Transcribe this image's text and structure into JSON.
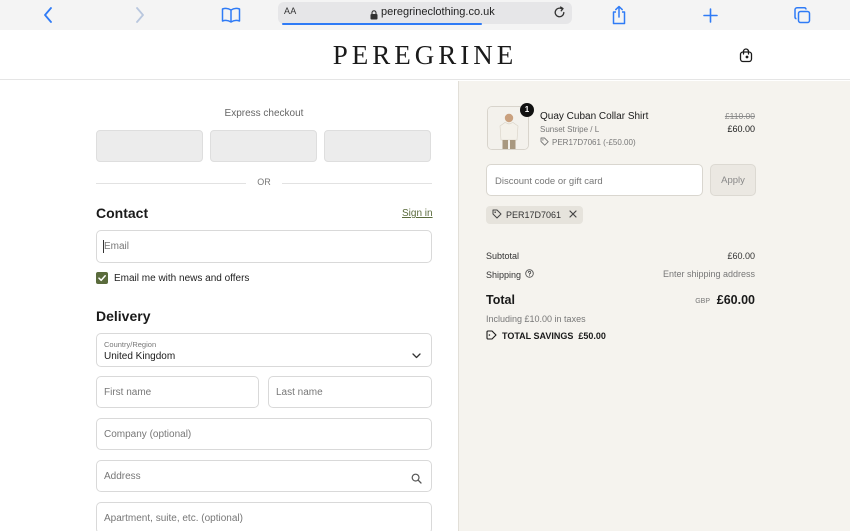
{
  "browser": {
    "text_size_label": "AA",
    "url": "peregrineclothing.co.uk",
    "accent": "#2f7bf6"
  },
  "header": {
    "logo": "PEREGRINE"
  },
  "checkout": {
    "express_label": "Express checkout",
    "or_label": "OR",
    "contact_title": "Contact",
    "signin_label": "Sign in",
    "email_placeholder": "Email",
    "newsletter_label": "Email me with news and offers",
    "newsletter_checked": true,
    "delivery_title": "Delivery",
    "country_caption": "Country/Region",
    "country_value": "United Kingdom",
    "first_name_placeholder": "First name",
    "last_name_placeholder": "Last name",
    "company_placeholder": "Company (optional)",
    "address_placeholder": "Address",
    "apartment_placeholder": "Apartment, suite, etc. (optional)",
    "accent": "#5a6b3c"
  },
  "summary": {
    "item": {
      "quantity": "1",
      "name": "Quay Cuban Collar Shirt",
      "variant": "Sunset Stripe / L",
      "discount_code": "PER17D7061 (-£50.00)",
      "price_original": "£110.00",
      "price_current": "£60.00"
    },
    "discount_placeholder": "Discount code or gift card",
    "apply_label": "Apply",
    "applied_code": "PER17D7061",
    "subtotal_label": "Subtotal",
    "subtotal_value": "£60.00",
    "shipping_label": "Shipping",
    "shipping_value": "Enter shipping address",
    "total_label": "Total",
    "total_currency": "GBP",
    "total_value": "£60.00",
    "tax_note": "Including £10.00 in taxes",
    "savings_label": "TOTAL SAVINGS",
    "savings_value": "£50.00"
  }
}
